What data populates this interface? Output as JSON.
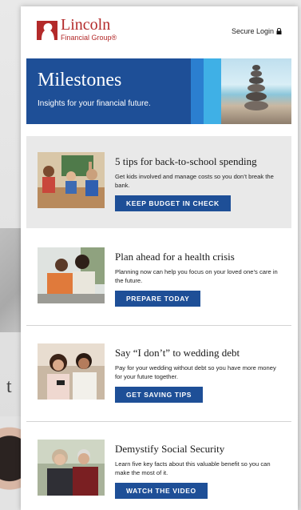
{
  "header": {
    "logo_name": "Lincoln",
    "logo_group": "Financial Group®",
    "secure_login": "Secure Login"
  },
  "banner": {
    "title": "Milestones",
    "subtitle": "Insights for your financial future."
  },
  "articles": [
    {
      "headline": "5 tips for back-to-school spending",
      "description": "Get kids involved and manage costs so you don’t break the bank.",
      "cta": "KEEP BUDGET IN CHECK"
    },
    {
      "headline": "Plan ahead for a health crisis",
      "description": "Planning now can help you focus on your loved one’s care in the future.",
      "cta": "PREPARE TODAY"
    },
    {
      "headline": "Say “I don’t” to wedding debt",
      "description": "Pay for your wedding without debt so you have more money for your future together.",
      "cta": "GET SAVING TIPS"
    },
    {
      "headline": "Demystify Social Security",
      "description": "Learn five key facts about this valuable benefit so you can make the most of it.",
      "cta": "WATCH THE VIDEO"
    }
  ],
  "background": {
    "partial_text": "t"
  },
  "colors": {
    "brand_red": "#b32a2a",
    "brand_blue": "#1e4f97",
    "accent_blue": "#2b7fd0",
    "accent_cyan": "#3fb0e6"
  }
}
